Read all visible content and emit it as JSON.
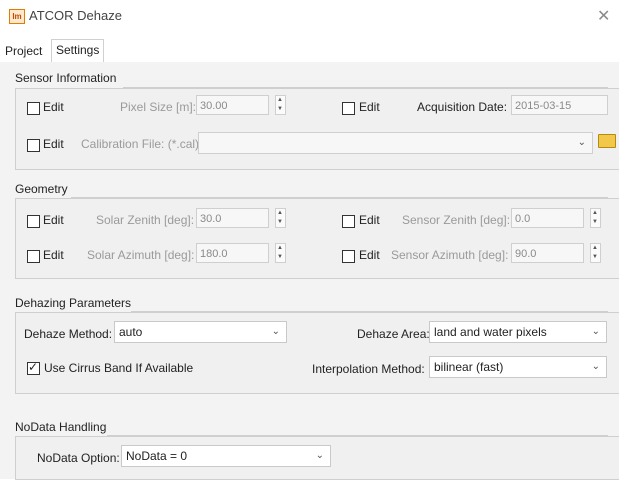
{
  "window": {
    "title": "ATCOR Dehaze",
    "app_icon_text": "Im",
    "close_glyph": "✕"
  },
  "tabs": [
    {
      "label": "Project"
    },
    {
      "label": "Settings"
    }
  ],
  "sensor": {
    "title": "Sensor Information",
    "edit_label": "Edit",
    "pixel_size_label": "Pixel Size [m]:",
    "pixel_size_value": "30.00",
    "acq_date_label": "Acquisition Date:",
    "acq_date_value": "2015-03-15",
    "calib_label": "Calibration File: (*.cal)",
    "calib_value": ""
  },
  "geometry": {
    "title": "Geometry",
    "edit_label": "Edit",
    "solar_zenith_label": "Solar Zenith [deg]:",
    "solar_zenith_value": "30.0",
    "sensor_zenith_label": "Sensor Zenith [deg]:",
    "sensor_zenith_value": "0.0",
    "solar_azimuth_label": "Solar Azimuth [deg]:",
    "solar_azimuth_value": "180.0",
    "sensor_azimuth_label": "Sensor Azimuth [deg]:",
    "sensor_azimuth_value": "90.0"
  },
  "dehazing": {
    "title": "Dehazing Parameters",
    "method_label": "Dehaze Method:",
    "method_value": "auto",
    "area_label": "Dehaze Area:",
    "area_value": "land and water pixels",
    "cirrus_label": "Use Cirrus Band If Available",
    "cirrus_checked": true,
    "interp_label": "Interpolation Method:",
    "interp_value": "bilinear (fast)"
  },
  "nodata": {
    "title": "NoData Handling",
    "option_label": "NoData Option:",
    "option_value": "NoData = 0"
  },
  "icons": {
    "dropdown": "⌄",
    "spin_up": "▲",
    "spin_down": "▼",
    "check": "✓"
  }
}
